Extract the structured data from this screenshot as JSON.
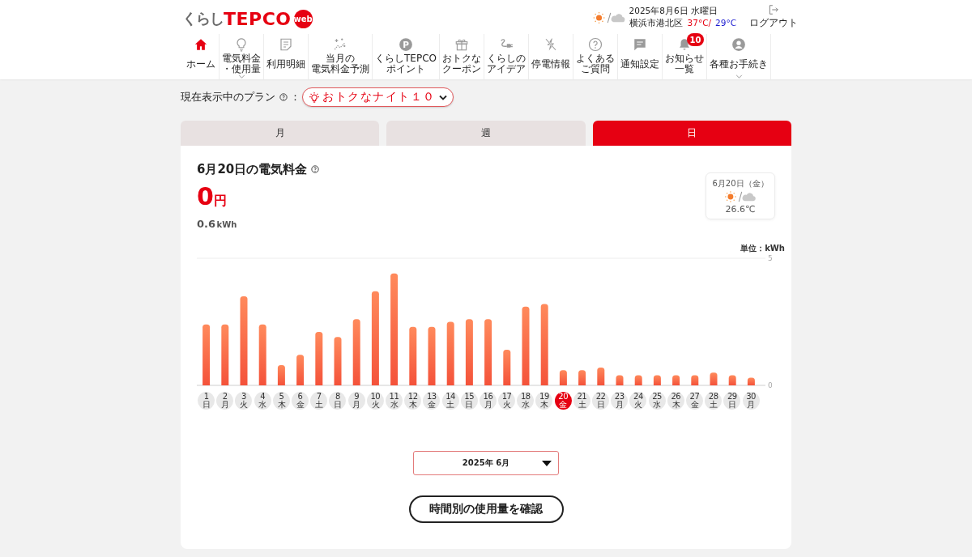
{
  "header": {
    "logo": {
      "kana": "くらし",
      "brand": "TEPCO",
      "badge": "web"
    },
    "weather": {
      "date": "2025年8月6日 水曜日",
      "location": "横浜市港北区",
      "high": "37°C/",
      "low": "29°C"
    },
    "logout": "ログアウト"
  },
  "nav": [
    {
      "lines": [
        "ホーム"
      ],
      "selected": true,
      "dropdown": false
    },
    {
      "lines": [
        "電気料金",
        "・使用量"
      ],
      "selected": false,
      "dropdown": true
    },
    {
      "lines": [
        "利用明細"
      ],
      "selected": false,
      "dropdown": false
    },
    {
      "lines": [
        "当月の",
        "電気料金予測"
      ],
      "selected": false,
      "dropdown": false
    },
    {
      "lines": [
        "くらしTEPCO",
        "ポイント"
      ],
      "selected": false,
      "dropdown": false,
      "icon_letter": "P"
    },
    {
      "lines": [
        "おトクな",
        "クーポン"
      ],
      "selected": false,
      "dropdown": false
    },
    {
      "lines": [
        "くらしの",
        "アイデア"
      ],
      "selected": false,
      "dropdown": false
    },
    {
      "lines": [
        "停電情報"
      ],
      "selected": false,
      "dropdown": false
    },
    {
      "lines": [
        "よくある",
        "ご質問"
      ],
      "selected": false,
      "dropdown": false
    },
    {
      "lines": [
        "通知設定"
      ],
      "selected": false,
      "dropdown": false
    },
    {
      "lines": [
        "お知らせ",
        "一覧"
      ],
      "selected": false,
      "dropdown": false,
      "badge": "10"
    },
    {
      "lines": [
        "各種お手続き"
      ],
      "selected": false,
      "dropdown": true
    }
  ],
  "plan": {
    "label": "現在表示中のプラン",
    "separator": "：",
    "value": "おトクなナイト１０"
  },
  "tabs": [
    {
      "label": "月",
      "selected": false
    },
    {
      "label": "週",
      "selected": false
    },
    {
      "label": "日",
      "selected": true
    }
  ],
  "summary": {
    "title": "6月20日の電気料金",
    "amount": "0",
    "currency": "円",
    "usage": "0.6",
    "usage_unit": "kWh"
  },
  "day_weather": {
    "date": "6月20日（金）",
    "temperature": "26.6℃"
  },
  "chart": {
    "chart_data": {
      "type": "bar",
      "ylabel": "単位：kWh",
      "categories": [
        "1",
        "2",
        "3",
        "4",
        "5",
        "6",
        "7",
        "8",
        "9",
        "10",
        "11",
        "12",
        "13",
        "14",
        "15",
        "16",
        "17",
        "18",
        "19",
        "20",
        "21",
        "22",
        "23",
        "24",
        "25",
        "26",
        "27",
        "28",
        "29",
        "30"
      ],
      "values": [
        2.4,
        2.4,
        3.5,
        2.4,
        0.8,
        1.2,
        2.1,
        1.9,
        2.6,
        3.7,
        4.4,
        2.3,
        2.3,
        2.5,
        2.6,
        2.6,
        1.4,
        3.1,
        3.2,
        0.6,
        0.6,
        0.7,
        0.4,
        0.4,
        0.4,
        0.4,
        0.4,
        0.5,
        0.4,
        0.3
      ],
      "ylim": [
        0,
        5
      ],
      "yticks": [
        0,
        5
      ]
    },
    "day_chips": [
      {
        "weekday": "日",
        "selected": false
      },
      {
        "weekday": "月",
        "selected": false
      },
      {
        "weekday": "火",
        "selected": false
      },
      {
        "weekday": "水",
        "selected": false
      },
      {
        "weekday": "木",
        "selected": false
      },
      {
        "weekday": "金",
        "selected": false
      },
      {
        "weekday": "土",
        "selected": false
      },
      {
        "weekday": "日",
        "selected": false
      },
      {
        "weekday": "月",
        "selected": false
      },
      {
        "weekday": "火",
        "selected": false
      },
      {
        "weekday": "水",
        "selected": false
      },
      {
        "weekday": "木",
        "selected": false
      },
      {
        "weekday": "金",
        "selected": false
      },
      {
        "weekday": "土",
        "selected": false
      },
      {
        "weekday": "日",
        "selected": false
      },
      {
        "weekday": "月",
        "selected": false
      },
      {
        "weekday": "火",
        "selected": false
      },
      {
        "weekday": "水",
        "selected": false
      },
      {
        "weekday": "木",
        "selected": false
      },
      {
        "weekday": "金",
        "selected": true
      },
      {
        "weekday": "土",
        "selected": false
      },
      {
        "weekday": "日",
        "selected": false
      },
      {
        "weekday": "月",
        "selected": false
      },
      {
        "weekday": "火",
        "selected": false
      },
      {
        "weekday": "水",
        "selected": false
      },
      {
        "weekday": "木",
        "selected": false
      },
      {
        "weekday": "金",
        "selected": false
      },
      {
        "weekday": "土",
        "selected": false
      },
      {
        "weekday": "日",
        "selected": false
      },
      {
        "weekday": "月",
        "selected": false
      }
    ]
  },
  "month_select": {
    "value": "2025年 6月"
  },
  "hourly_button": "時間別の使用量を確認"
}
